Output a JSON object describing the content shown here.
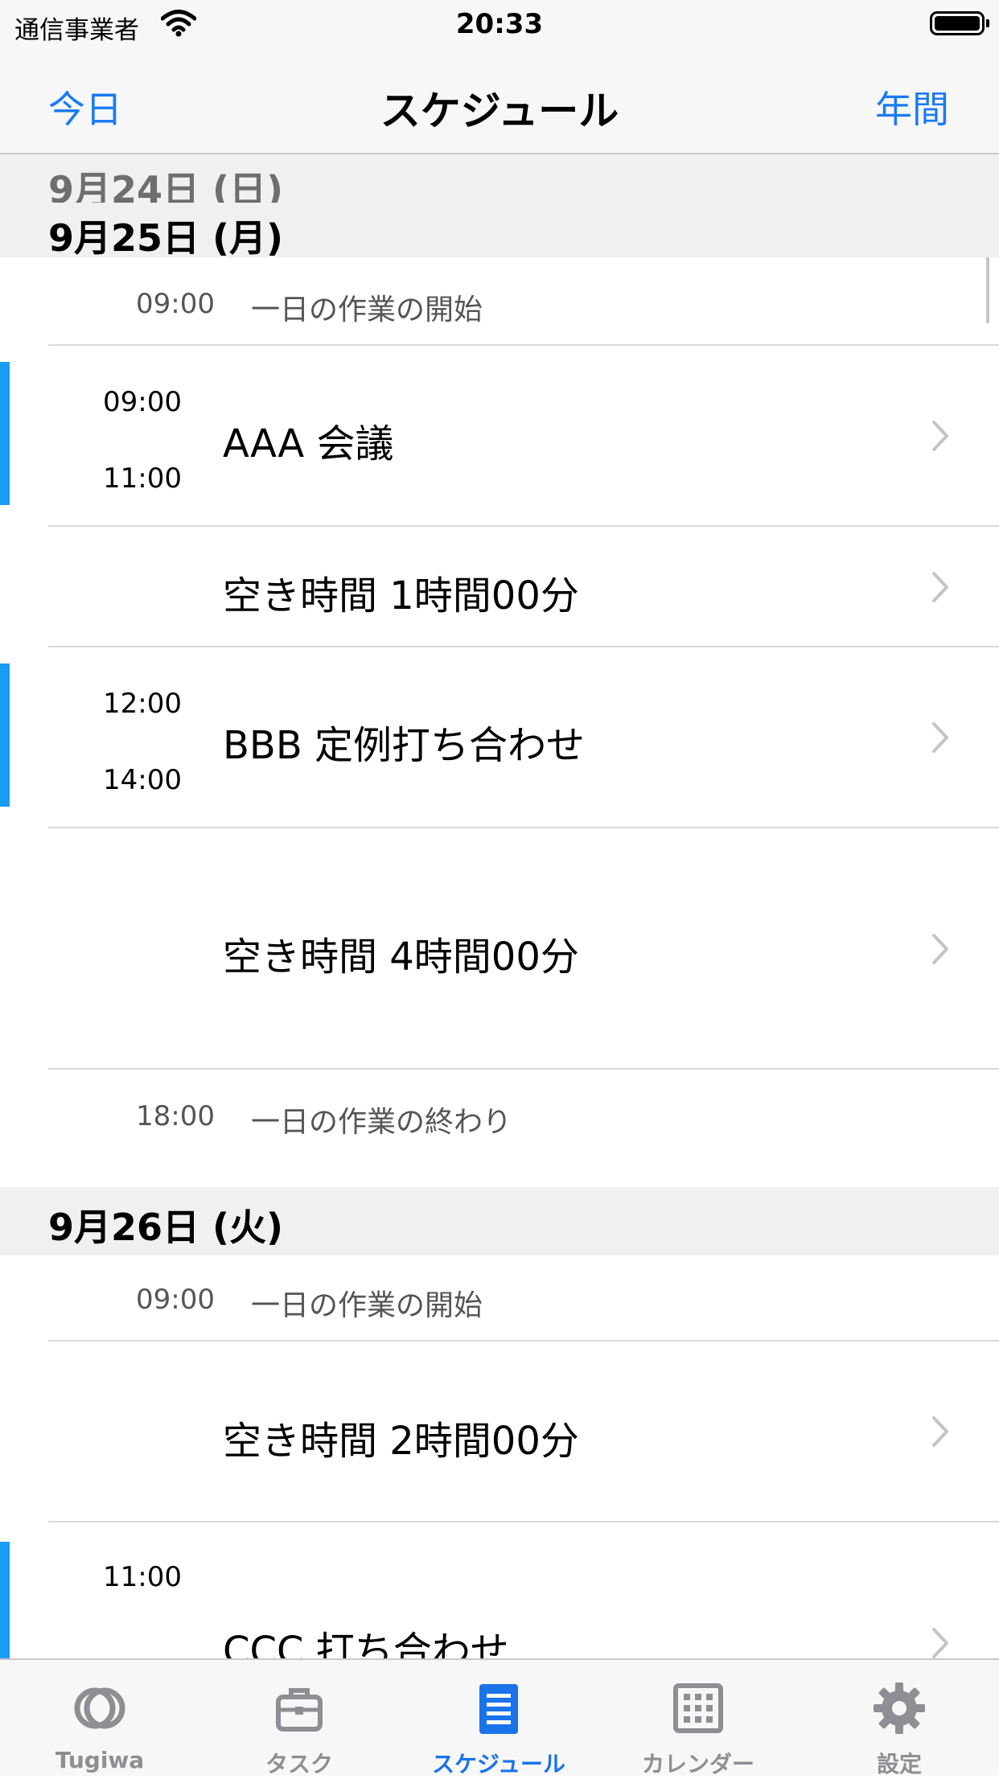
{
  "status_bar": {
    "carrier": "通信事業者",
    "time": "20:33"
  },
  "nav": {
    "left_button": "今日",
    "title": "スケジュール",
    "right_button": "年間"
  },
  "days": {
    "d24": {
      "label": "9月24日 (日)"
    },
    "d25": {
      "label": "9月25日 (月)",
      "start": {
        "time": "09:00",
        "label": "一日の作業の開始"
      },
      "items": [
        {
          "type": "event",
          "start": "09:00",
          "end": "11:00",
          "title": "AAA 会議"
        },
        {
          "type": "free",
          "title": "空き時間 1時間00分"
        },
        {
          "type": "event",
          "start": "12:00",
          "end": "14:00",
          "title": "BBB 定例打ち合わせ"
        },
        {
          "type": "free",
          "title": "空き時間 4時間00分"
        }
      ],
      "end": {
        "time": "18:00",
        "label": "一日の作業の終わり"
      }
    },
    "d26": {
      "label": "9月26日 (火)",
      "start": {
        "time": "09:00",
        "label": "一日の作業の開始"
      },
      "items": [
        {
          "type": "free",
          "title": "空き時間 2時間00分"
        },
        {
          "type": "event",
          "start": "11:00",
          "title": "CCC 打ち合わせ"
        }
      ]
    }
  },
  "tab_bar": {
    "items": [
      {
        "label": "Tugiwa",
        "icon": "rings-icon"
      },
      {
        "label": "タスク",
        "icon": "briefcase-icon"
      },
      {
        "label": "スケジュール",
        "icon": "list-icon",
        "active": true
      },
      {
        "label": "カレンダー",
        "icon": "calendar-grid-icon"
      },
      {
        "label": "設定",
        "icon": "gear-icon"
      }
    ]
  },
  "colors": {
    "accent_blue": "#1a7bf2",
    "event_bar": "#1a9cf5",
    "separator": "#d9d9d9",
    "header_bg": "#f0f0f1"
  }
}
